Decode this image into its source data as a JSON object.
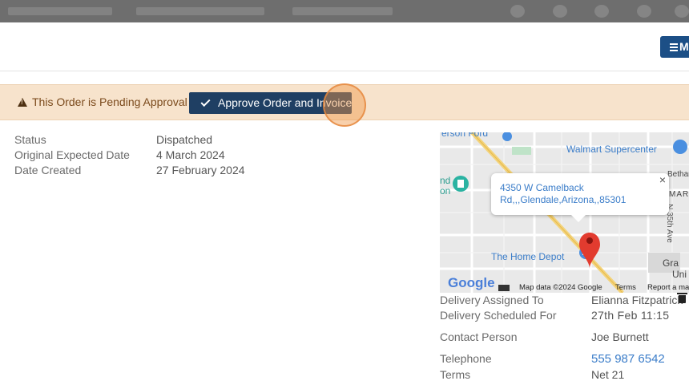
{
  "header": {
    "menu_label": "M"
  },
  "alert": {
    "message": "This Order is Pending Approval",
    "approve_label": "Approve Order and Invoice"
  },
  "details": [
    {
      "label": "Status",
      "value": "Dispatched"
    },
    {
      "label": "Original Expected Date",
      "value": "4 March 2024"
    },
    {
      "label": "Date Created",
      "value": "27 February 2024"
    }
  ],
  "map": {
    "info_line1": "4350 W Camelback",
    "info_line2": "Rd,,,Glendale,Arizona,,85301",
    "close_glyph": "×",
    "labels": {
      "walmart": "Walmart Supercenter",
      "home_depot": "The Home Depot",
      "nd": "nd",
      "nd2": "on",
      "bethany": "Bethan",
      "mart": "MART",
      "ave": "N 35th Ave",
      "gran": "Gra",
      "uni": "Uni",
      "top": "erson Ford"
    },
    "logo": "Google",
    "map_data": "Map data ©2024 Google",
    "terms": "Terms",
    "report": "Report a ma"
  },
  "info": [
    {
      "label": "Delivery Assigned To",
      "value": "Elianna Fitzpatrick"
    },
    {
      "label": "Delivery Scheduled For",
      "value": "27th Feb 11:15"
    },
    {
      "label": "Contact Person",
      "value": "Joe Burnett"
    },
    {
      "label": "Telephone",
      "value": "555 987 6542"
    },
    {
      "label": "Terms",
      "value": "Net 21"
    }
  ],
  "colors": {
    "primary": "#1f3f63",
    "menu": "#1c4f86",
    "alert_bg": "#f7e3cc",
    "link": "#3b7dc9"
  }
}
